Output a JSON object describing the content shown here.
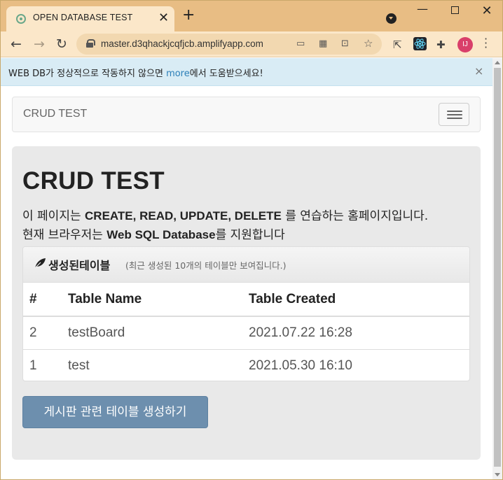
{
  "browser": {
    "tab_title": "OPEN DATABASE TEST",
    "tab_close": "✕",
    "new_tab": "+",
    "url": "master.d3qhackjcqfjcb.amplifyapp.com",
    "profile_initials": "IJ"
  },
  "alert": {
    "text_before": "WEB DB가 정상적으로 작동하지 않으면 ",
    "link": "more",
    "text_after": "에서 도움받으세요!",
    "close": "×"
  },
  "navbar": {
    "brand": "CRUD TEST"
  },
  "jumbotron": {
    "title": "CRUD TEST",
    "line1_prefix": "이 페이지는 ",
    "line1_bold": "CREATE, READ, UPDATE, DELETE",
    "line1_suffix": " 를 연습하는 홈페이지입니다.",
    "line2_prefix": "현재 브라우저는 ",
    "line2_bold": "Web SQL Database",
    "line2_suffix": "를 지원합니다"
  },
  "panel": {
    "title": "생성된테이블",
    "subtitle": "(최근 생성된 10개의 테이블만 보여집니다.)",
    "columns": [
      "#",
      "Table Name",
      "Table Created"
    ],
    "rows": [
      {
        "id": "2",
        "name": "testBoard",
        "created": "2021.07.22 16:28"
      },
      {
        "id": "1",
        "name": "test",
        "created": "2021.05.30 16:10"
      }
    ]
  },
  "create_button": "게시판 관련 테이블 생성하기",
  "colors": {
    "tabstrip": "#e8bd84",
    "toolbar": "#fbe7c9",
    "alert_bg": "#d9ecf5",
    "button": "#6d8fae"
  }
}
